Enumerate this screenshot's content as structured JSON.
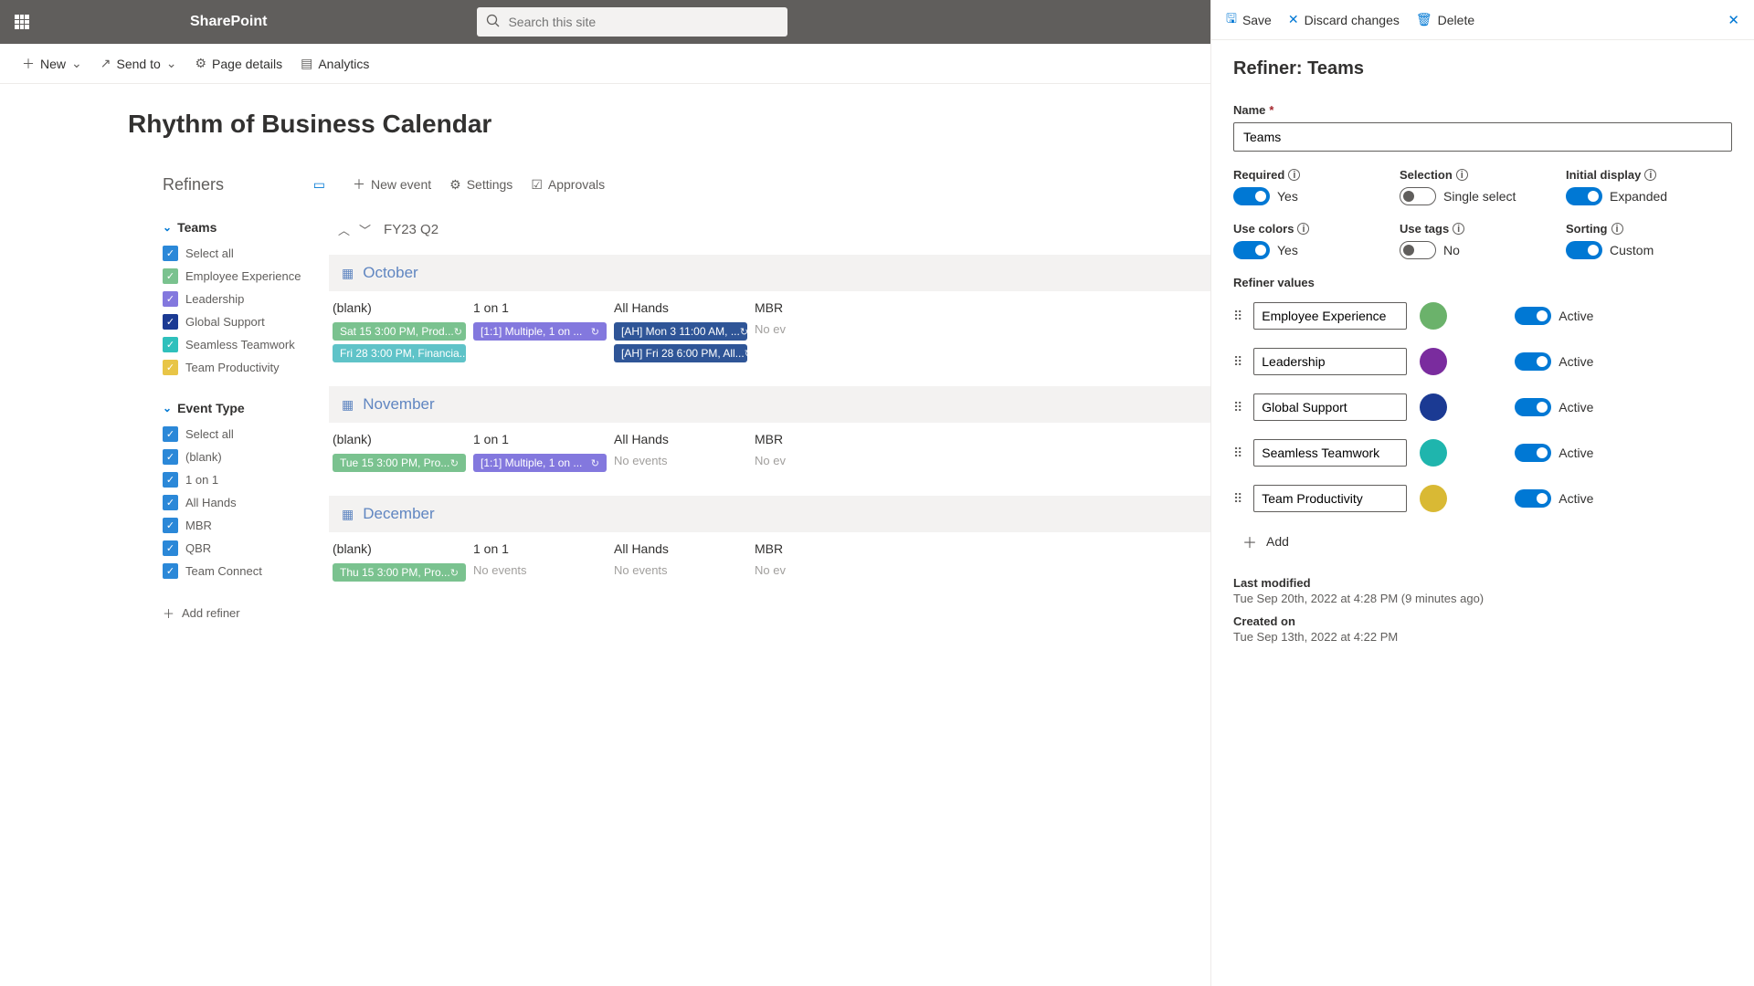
{
  "suite": {
    "title": "SharePoint",
    "search_ph": "Search this site"
  },
  "command_bar": {
    "new": "New",
    "send": "Send to",
    "details": "Page details",
    "analytics": "Analytics"
  },
  "page": {
    "title": "Rhythm of Business Calendar"
  },
  "refiners": {
    "heading": "Refiners",
    "add": "Add refiner",
    "groups": [
      {
        "name": "Teams",
        "items": [
          {
            "label": "Select all",
            "chk": "blue"
          },
          {
            "label": "Employee Experience",
            "chk": "green"
          },
          {
            "label": "Leadership",
            "chk": "purple"
          },
          {
            "label": "Global Support",
            "chk": "navy"
          },
          {
            "label": "Seamless Teamwork",
            "chk": "teal"
          },
          {
            "label": "Team Productivity",
            "chk": "yellow"
          }
        ]
      },
      {
        "name": "Event Type",
        "items": [
          {
            "label": "Select all",
            "chk": "blue"
          },
          {
            "label": "(blank)",
            "chk": "blue"
          },
          {
            "label": "1 on 1",
            "chk": "blue"
          },
          {
            "label": "All Hands",
            "chk": "blue"
          },
          {
            "label": "MBR",
            "chk": "blue"
          },
          {
            "label": "QBR",
            "chk": "blue"
          },
          {
            "label": "Team Connect",
            "chk": "blue"
          }
        ]
      }
    ]
  },
  "calendar": {
    "toolbar": {
      "new": "New event",
      "settings": "Settings",
      "approvals": "Approvals"
    },
    "period": "FY23 Q2",
    "months": [
      {
        "name": "October",
        "cols": [
          {
            "title": "(blank)",
            "pills": [
              {
                "cls": "green",
                "text": "Sat 15 3:00 PM, Prod..."
              },
              {
                "cls": "teal",
                "text": "Fri 28 3:00 PM, Financia..."
              }
            ]
          },
          {
            "title": "1 on 1",
            "pills": [
              {
                "cls": "purple",
                "text": "[1:1]  Multiple, 1 on ..."
              }
            ]
          },
          {
            "title": "All Hands",
            "pills": [
              {
                "cls": "navy",
                "text": "[AH]  Mon 3 11:00 AM, ..."
              },
              {
                "cls": "navy",
                "text": "[AH]  Fri 28 6:00 PM, All..."
              }
            ]
          },
          {
            "title": "MBR",
            "noev": "No ev"
          }
        ]
      },
      {
        "name": "November",
        "cols": [
          {
            "title": "(blank)",
            "pills": [
              {
                "cls": "green",
                "text": "Tue 15 3:00 PM, Pro..."
              }
            ]
          },
          {
            "title": "1 on 1",
            "pills": [
              {
                "cls": "purple",
                "text": "[1:1]  Multiple, 1 on ..."
              }
            ]
          },
          {
            "title": "All Hands",
            "noev": "No events"
          },
          {
            "title": "MBR",
            "noev": "No ev"
          }
        ]
      },
      {
        "name": "December",
        "cols": [
          {
            "title": "(blank)",
            "pills": [
              {
                "cls": "green",
                "text": "Thu 15 3:00 PM, Pro..."
              }
            ]
          },
          {
            "title": "1 on 1",
            "noev": "No events"
          },
          {
            "title": "All Hands",
            "noev": "No events"
          },
          {
            "title": "MBR",
            "noev": "No ev"
          }
        ]
      }
    ]
  },
  "panel": {
    "top": {
      "save": "Save",
      "discard": "Discard changes",
      "delete": "Delete"
    },
    "title": "Refiner: Teams",
    "name_label": "Name",
    "name_value": "Teams",
    "toggles1": [
      {
        "label": "Required",
        "value": "Yes",
        "on": true
      },
      {
        "label": "Selection",
        "value": "Single select",
        "on": false
      },
      {
        "label": "Initial display",
        "value": "Expanded",
        "on": true
      }
    ],
    "toggles2": [
      {
        "label": "Use colors",
        "value": "Yes",
        "on": true
      },
      {
        "label": "Use tags",
        "value": "No",
        "on": false
      },
      {
        "label": "Sorting",
        "value": "Custom",
        "on": true
      }
    ],
    "rv_label": "Refiner values",
    "rv_active": "Active",
    "values": [
      {
        "name": "Employee Experience",
        "dot": "dot-green"
      },
      {
        "name": "Leadership",
        "dot": "dot-purple"
      },
      {
        "name": "Global Support",
        "dot": "dot-navy"
      },
      {
        "name": "Seamless Teamwork",
        "dot": "dot-teal"
      },
      {
        "name": "Team Productivity",
        "dot": "dot-yellow"
      }
    ],
    "add": "Add",
    "meta": {
      "lm_label": "Last modified",
      "lm_val": "Tue Sep 20th, 2022 at 4:28 PM (9 minutes ago)",
      "co_label": "Created on",
      "co_val": "Tue Sep 13th, 2022 at 4:22 PM"
    }
  }
}
